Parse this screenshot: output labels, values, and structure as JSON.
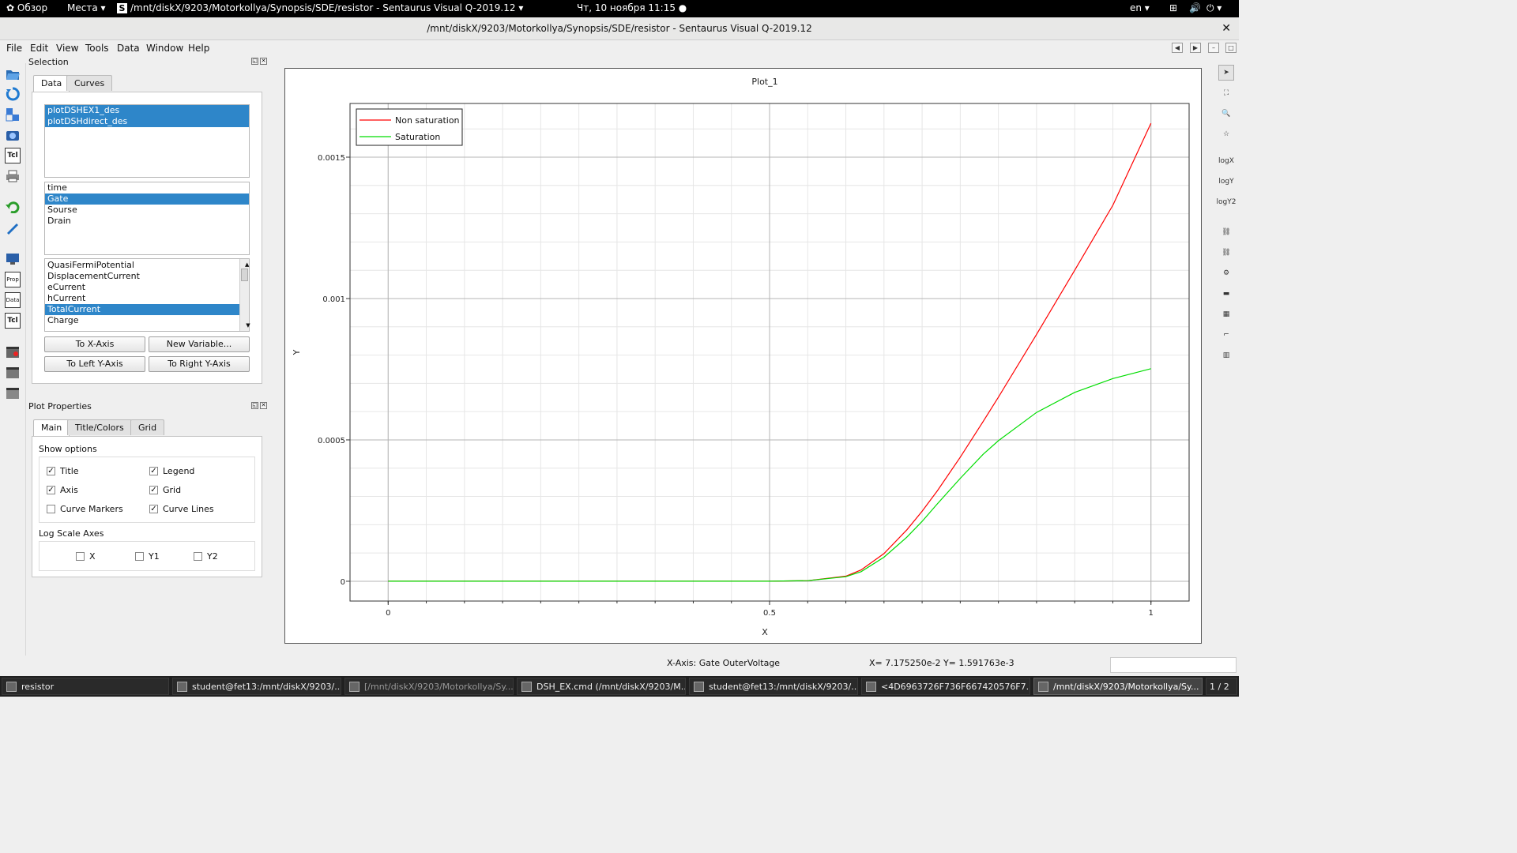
{
  "topbar": {
    "overview": "Обзор",
    "places": "Места ▾",
    "app_title": "/mnt/diskX/9203/Motorkollya/Synopsis/SDE/resistor - Sentaurus Visual Q-2019.12 ▾",
    "datetime": "Чт, 10 ноября  11:15 ●",
    "lang": "en ▾"
  },
  "window": {
    "title": "/mnt/diskX/9203/Motorkollya/Synopsis/SDE/resistor - Sentaurus Visual Q-2019.12",
    "close": "✕"
  },
  "menu": [
    "File",
    "Edit",
    "View",
    "Tools",
    "Data",
    "Window",
    "Help"
  ],
  "selection": {
    "title": "Selection",
    "tabs": [
      "Data",
      "Curves"
    ],
    "datasets": [
      "plotDSHEX1_des",
      "plotDSHdirect_des"
    ],
    "groups": [
      {
        "label": "time",
        "selected": false
      },
      {
        "label": "Gate",
        "selected": true
      },
      {
        "label": "Sourse",
        "selected": false
      },
      {
        "label": "Drain",
        "selected": false
      }
    ],
    "variables": [
      {
        "label": "QuasiFermiPotential",
        "selected": false
      },
      {
        "label": "DisplacementCurrent",
        "selected": false
      },
      {
        "label": "eCurrent",
        "selected": false
      },
      {
        "label": "hCurrent",
        "selected": false
      },
      {
        "label": "TotalCurrent",
        "selected": true
      },
      {
        "label": "Charge",
        "selected": false
      }
    ],
    "buttons": {
      "to_x": "To X-Axis",
      "new_var": "New Variable...",
      "to_left_y": "To Left Y-Axis",
      "to_right_y": "To Right Y-Axis"
    }
  },
  "plot_properties": {
    "title": "Plot Properties",
    "tabs": [
      "Main",
      "Title/Colors",
      "Grid"
    ],
    "show_options_label": "Show options",
    "options": {
      "title": {
        "label": "Title",
        "checked": true
      },
      "legend": {
        "label": "Legend",
        "checked": true
      },
      "axis": {
        "label": "Axis",
        "checked": true
      },
      "grid": {
        "label": "Grid",
        "checked": true
      },
      "curve_markers": {
        "label": "Curve Markers",
        "checked": false
      },
      "curve_lines": {
        "label": "Curve Lines",
        "checked": true
      }
    },
    "log_scale_label": "Log Scale Axes",
    "log_axes": [
      {
        "label": "X",
        "checked": false
      },
      {
        "label": "Y1",
        "checked": false
      },
      {
        "label": "Y2",
        "checked": false
      }
    ]
  },
  "chart_data": {
    "type": "line",
    "title": "Plot_1",
    "xlabel": "X",
    "ylabel": "Y",
    "xlim": [
      -0.05,
      1.05
    ],
    "ylim": [
      -7e-05,
      0.00169
    ],
    "xticks": [
      0,
      0.5,
      1
    ],
    "xtick_labels": [
      "0",
      "0.5",
      "1"
    ],
    "yticks": [
      0,
      0.0005,
      0.001,
      0.0015
    ],
    "ytick_labels": [
      "0",
      "0.0005",
      "0.001",
      "0.0015"
    ],
    "grid": true,
    "legend_position": "top-left",
    "series": [
      {
        "name": "Non saturation",
        "color": "#ff0000",
        "x": [
          0,
          0.5,
          0.55,
          0.6,
          0.62,
          0.65,
          0.68,
          0.7,
          0.72,
          0.75,
          0.78,
          0.8,
          0.85,
          0.9,
          0.95,
          1.0
        ],
        "y": [
          0,
          0,
          2e-06,
          1.8e-05,
          4e-05,
          9.8e-05,
          0.000182,
          0.000248,
          0.00032,
          0.000439,
          0.000565,
          0.000651,
          0.000873,
          0.0011,
          0.00133,
          0.00162
        ]
      },
      {
        "name": "Saturation",
        "color": "#00dd00",
        "x": [
          0,
          0.5,
          0.55,
          0.6,
          0.62,
          0.65,
          0.68,
          0.7,
          0.72,
          0.75,
          0.78,
          0.8,
          0.85,
          0.9,
          0.95,
          1.0
        ],
        "y": [
          0,
          0,
          2e-06,
          1.6e-05,
          3.4e-05,
          8.5e-05,
          0.000156,
          0.000212,
          0.000274,
          0.000364,
          0.000449,
          0.000497,
          0.000597,
          0.000668,
          0.000717,
          0.000752
        ]
      }
    ]
  },
  "status": {
    "x_axis": "X-Axis: Gate OuterVoltage",
    "coords": "X= 7.175250e-2     Y= 1.591763e-3"
  },
  "taskbar": {
    "items": [
      "resistor",
      "student@fet13:/mnt/diskX/9203/...",
      "[/mnt/diskX/9203/Motorkollya/Sy...",
      "DSH_EX.cmd (/mnt/diskX/9203/M...",
      "student@fet13:/mnt/diskX/9203/...",
      "<4D6963726F736F667420576F7...",
      "/mnt/diskX/9203/Motorkollya/Sy..."
    ],
    "pager": "1 / 2"
  }
}
